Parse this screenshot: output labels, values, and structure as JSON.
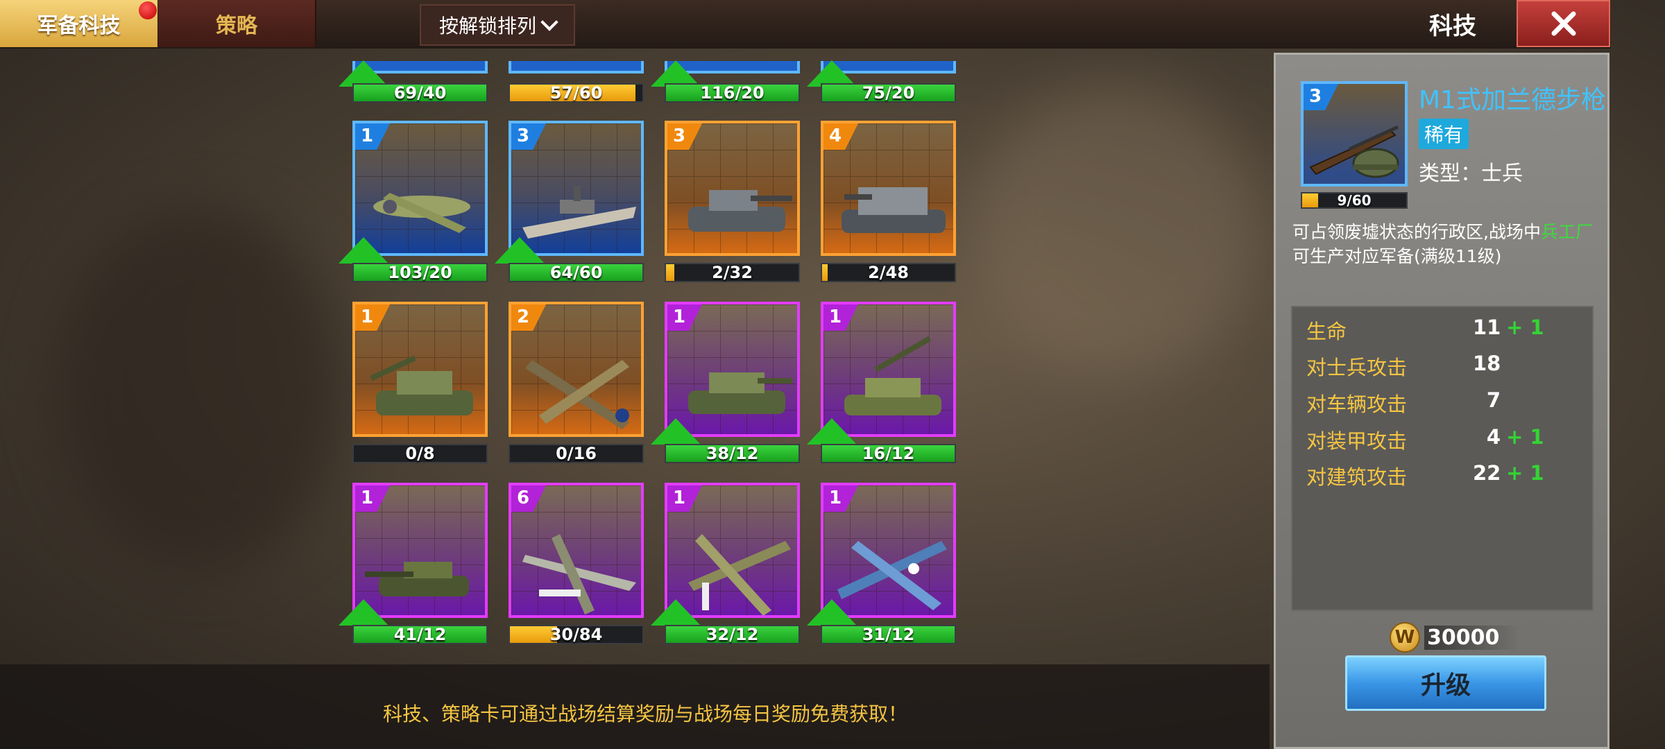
{
  "tabs": {
    "active": "军备科技",
    "inactive": "策略"
  },
  "sort_label": "按解锁排列",
  "header_title": "科技",
  "hint": "科技、策略卡可通过战场结算奖励与战场每日奖励免费获取！",
  "row0": [
    {
      "progress": "69/40",
      "fill": 1.0,
      "bar": "green",
      "arrow": true
    },
    {
      "progress": "57/60",
      "fill": 0.95,
      "bar": "yellow",
      "arrow": false
    },
    {
      "progress": "116/20",
      "fill": 1.0,
      "bar": "green",
      "arrow": true
    },
    {
      "progress": "75/20",
      "fill": 1.0,
      "bar": "green",
      "arrow": true
    }
  ],
  "cards": [
    {
      "level": "1",
      "rarity": "blue",
      "unit": "transport-plane",
      "progress": "103/20",
      "fill": 1.0,
      "bar": "green",
      "arrow": true
    },
    {
      "level": "3",
      "rarity": "blue",
      "unit": "battleship",
      "progress": "64/60",
      "fill": 1.0,
      "bar": "green",
      "arrow": true
    },
    {
      "level": "3",
      "rarity": "orange",
      "unit": "tiger-tank",
      "progress": "2/32",
      "fill": 0.0625,
      "bar": "yellow",
      "arrow": false
    },
    {
      "level": "4",
      "rarity": "orange",
      "unit": "heavy-tank-destroyer",
      "progress": "2/48",
      "fill": 0.0417,
      "bar": "yellow",
      "arrow": false
    },
    {
      "level": "1",
      "rarity": "orange",
      "unit": "self-propelled-gun",
      "progress": "0/8",
      "fill": 0.0,
      "bar": "yellow",
      "arrow": false
    },
    {
      "level": "2",
      "rarity": "orange",
      "unit": "camouflage-bomber",
      "progress": "0/16",
      "fill": 0.0,
      "bar": "yellow",
      "arrow": false
    },
    {
      "level": "1",
      "rarity": "purple",
      "unit": "medium-tank",
      "progress": "38/12",
      "fill": 1.0,
      "bar": "green",
      "arrow": true
    },
    {
      "level": "1",
      "rarity": "purple",
      "unit": "artillery-vehicle",
      "progress": "16/12",
      "fill": 1.0,
      "bar": "green",
      "arrow": true
    },
    {
      "level": "1",
      "rarity": "purple",
      "unit": "tank-destroyer",
      "progress": "41/12",
      "fill": 1.0,
      "bar": "green",
      "arrow": true
    },
    {
      "level": "6",
      "rarity": "purple",
      "unit": "spitfire-fighter",
      "progress": "30/84",
      "fill": 0.357,
      "bar": "yellow",
      "arrow": false
    },
    {
      "level": "1",
      "rarity": "purple",
      "unit": "twin-engine-bomber",
      "progress": "32/12",
      "fill": 1.0,
      "bar": "green",
      "arrow": true
    },
    {
      "level": "1",
      "rarity": "purple",
      "unit": "corsair-fighter",
      "progress": "31/12",
      "fill": 1.0,
      "bar": "green",
      "arrow": true
    }
  ],
  "selected": {
    "level": "3",
    "name": "M1式加兰德步枪",
    "rarity": "稀有",
    "type": "类型：士兵",
    "progress": "9/60",
    "fill": 0.15,
    "desc_1": "可占领废墟状态的行政区,战场中",
    "desc_highlight": "兵工厂",
    "desc_2": "可生产对应军备(满级11级)",
    "stats": [
      {
        "label": "生命",
        "value": "11",
        "bonus": "+ 1"
      },
      {
        "label": "对士兵攻击",
        "value": "18",
        "bonus": ""
      },
      {
        "label": "对车辆攻击",
        "value": "7",
        "bonus": ""
      },
      {
        "label": "对装甲攻击",
        "value": "4",
        "bonus": "+ 1"
      },
      {
        "label": "对建筑攻击",
        "value": "22",
        "bonus": "+ 1"
      }
    ],
    "cost": "30000",
    "coin_symbol": "W",
    "upgrade_label": "升级"
  },
  "colors": {
    "green": "#22c227",
    "yellow": "#f0a81a",
    "blue": "#5fb8ff",
    "orange": "#ffa233",
    "purple": "#e23cff"
  }
}
